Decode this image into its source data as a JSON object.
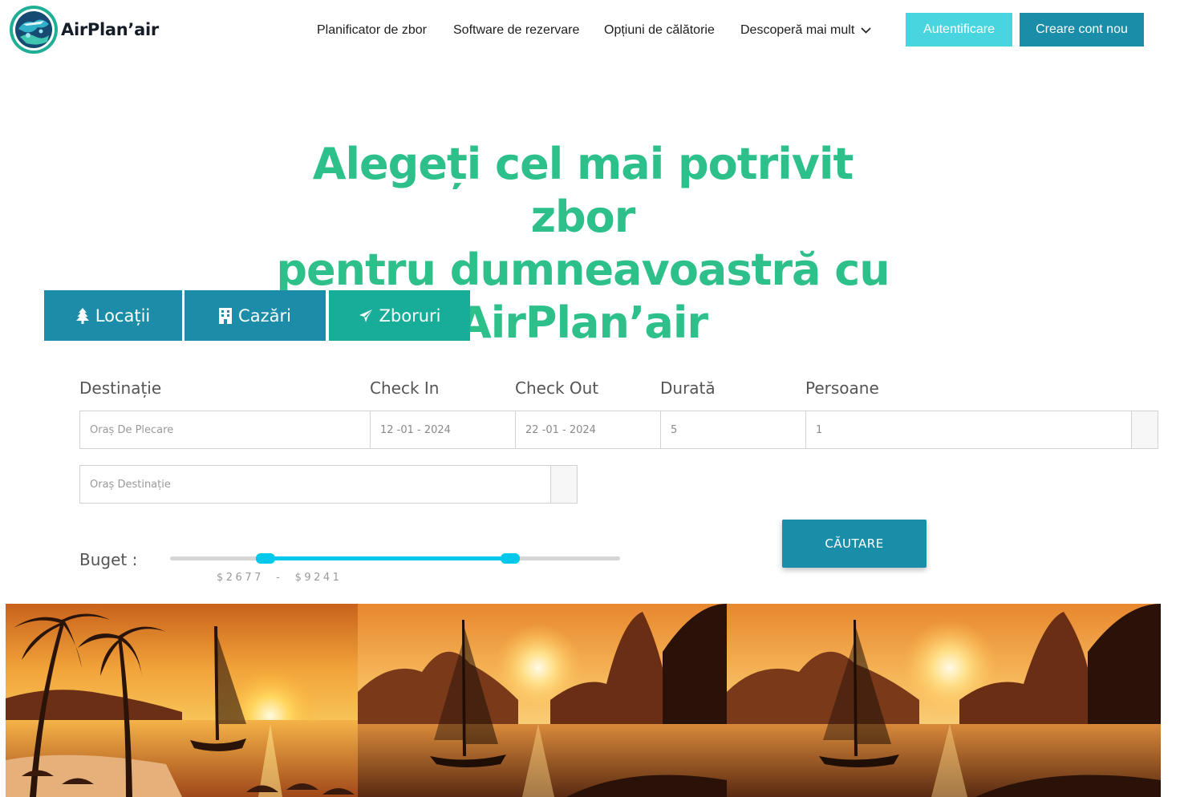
{
  "brand": {
    "name": "AirPlan’air"
  },
  "nav": {
    "items": [
      {
        "label": "Planificator de zbor"
      },
      {
        "label": "Software de rezervare"
      },
      {
        "label": "Opțiuni de călătorie"
      },
      {
        "label": "Descoperă mai mult",
        "icon": "chevron-down-icon"
      }
    ],
    "login_label": "Autentificare",
    "signup_label": "Creare cont nou"
  },
  "hero": {
    "title_line1": "Alegeți cel mai potrivit zbor",
    "title_line2": "pentru dumneavoastră cu",
    "title_line3": "AirPlan’air"
  },
  "tabs": [
    {
      "label": "Locații",
      "icon": "tree-icon"
    },
    {
      "label": "Cazări",
      "icon": "building-icon"
    },
    {
      "label": "Zboruri",
      "icon": "plane-icon",
      "active": true
    }
  ],
  "form": {
    "labels": {
      "destination": "Destinație",
      "check_in": "Check In",
      "check_out": "Check Out",
      "duration": "Durată",
      "persons": "Persoane"
    },
    "departure_placeholder": "Oraș De Plecare",
    "check_in_value": "12 -01 - 2024",
    "check_out_value": "22 -01 - 2024",
    "duration_value": "5",
    "persons_value": "1",
    "destination_placeholder": "Oraș Destinație"
  },
  "budget": {
    "label": "Buget :",
    "range_text": "$2677  -  $9241",
    "min_fraction": 0.213,
    "max_fraction": 0.755
  },
  "search": {
    "label": "CĂUTARE"
  },
  "colors": {
    "accent_green": "#2ec08a",
    "primary_blue": "#1a8da9",
    "light_cyan": "#49d5df",
    "slider": "#00c8ea",
    "active_tab": "#17ad99"
  },
  "gallery": [
    {
      "name": "sunset-beach-palms-photo"
    },
    {
      "name": "sailboat-mountains-sunset-photo"
    },
    {
      "name": "sailboat-mountains-sunset-photo-2"
    }
  ]
}
